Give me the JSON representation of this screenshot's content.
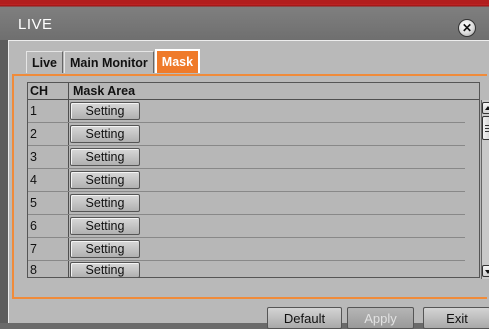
{
  "window": {
    "title": "LIVE"
  },
  "tabs": [
    {
      "label": "Live",
      "active": false
    },
    {
      "label": "Main Monitor",
      "active": false
    },
    {
      "label": "Mask",
      "active": true
    }
  ],
  "table": {
    "headers": {
      "ch": "CH",
      "mask_area": "Mask Area"
    },
    "rows": [
      {
        "ch": "1",
        "button": "Setting"
      },
      {
        "ch": "2",
        "button": "Setting"
      },
      {
        "ch": "3",
        "button": "Setting"
      },
      {
        "ch": "4",
        "button": "Setting"
      },
      {
        "ch": "5",
        "button": "Setting"
      },
      {
        "ch": "6",
        "button": "Setting"
      },
      {
        "ch": "7",
        "button": "Setting"
      },
      {
        "ch": "8",
        "button": "Setting"
      }
    ]
  },
  "footer": {
    "default_label": "Default",
    "apply_label": "Apply",
    "exit_label": "Exit"
  },
  "colors": {
    "accent": "#ef7a2a",
    "title_bar_accent": "#b21e1e"
  },
  "icons": {
    "close": "close-circle-icon"
  }
}
